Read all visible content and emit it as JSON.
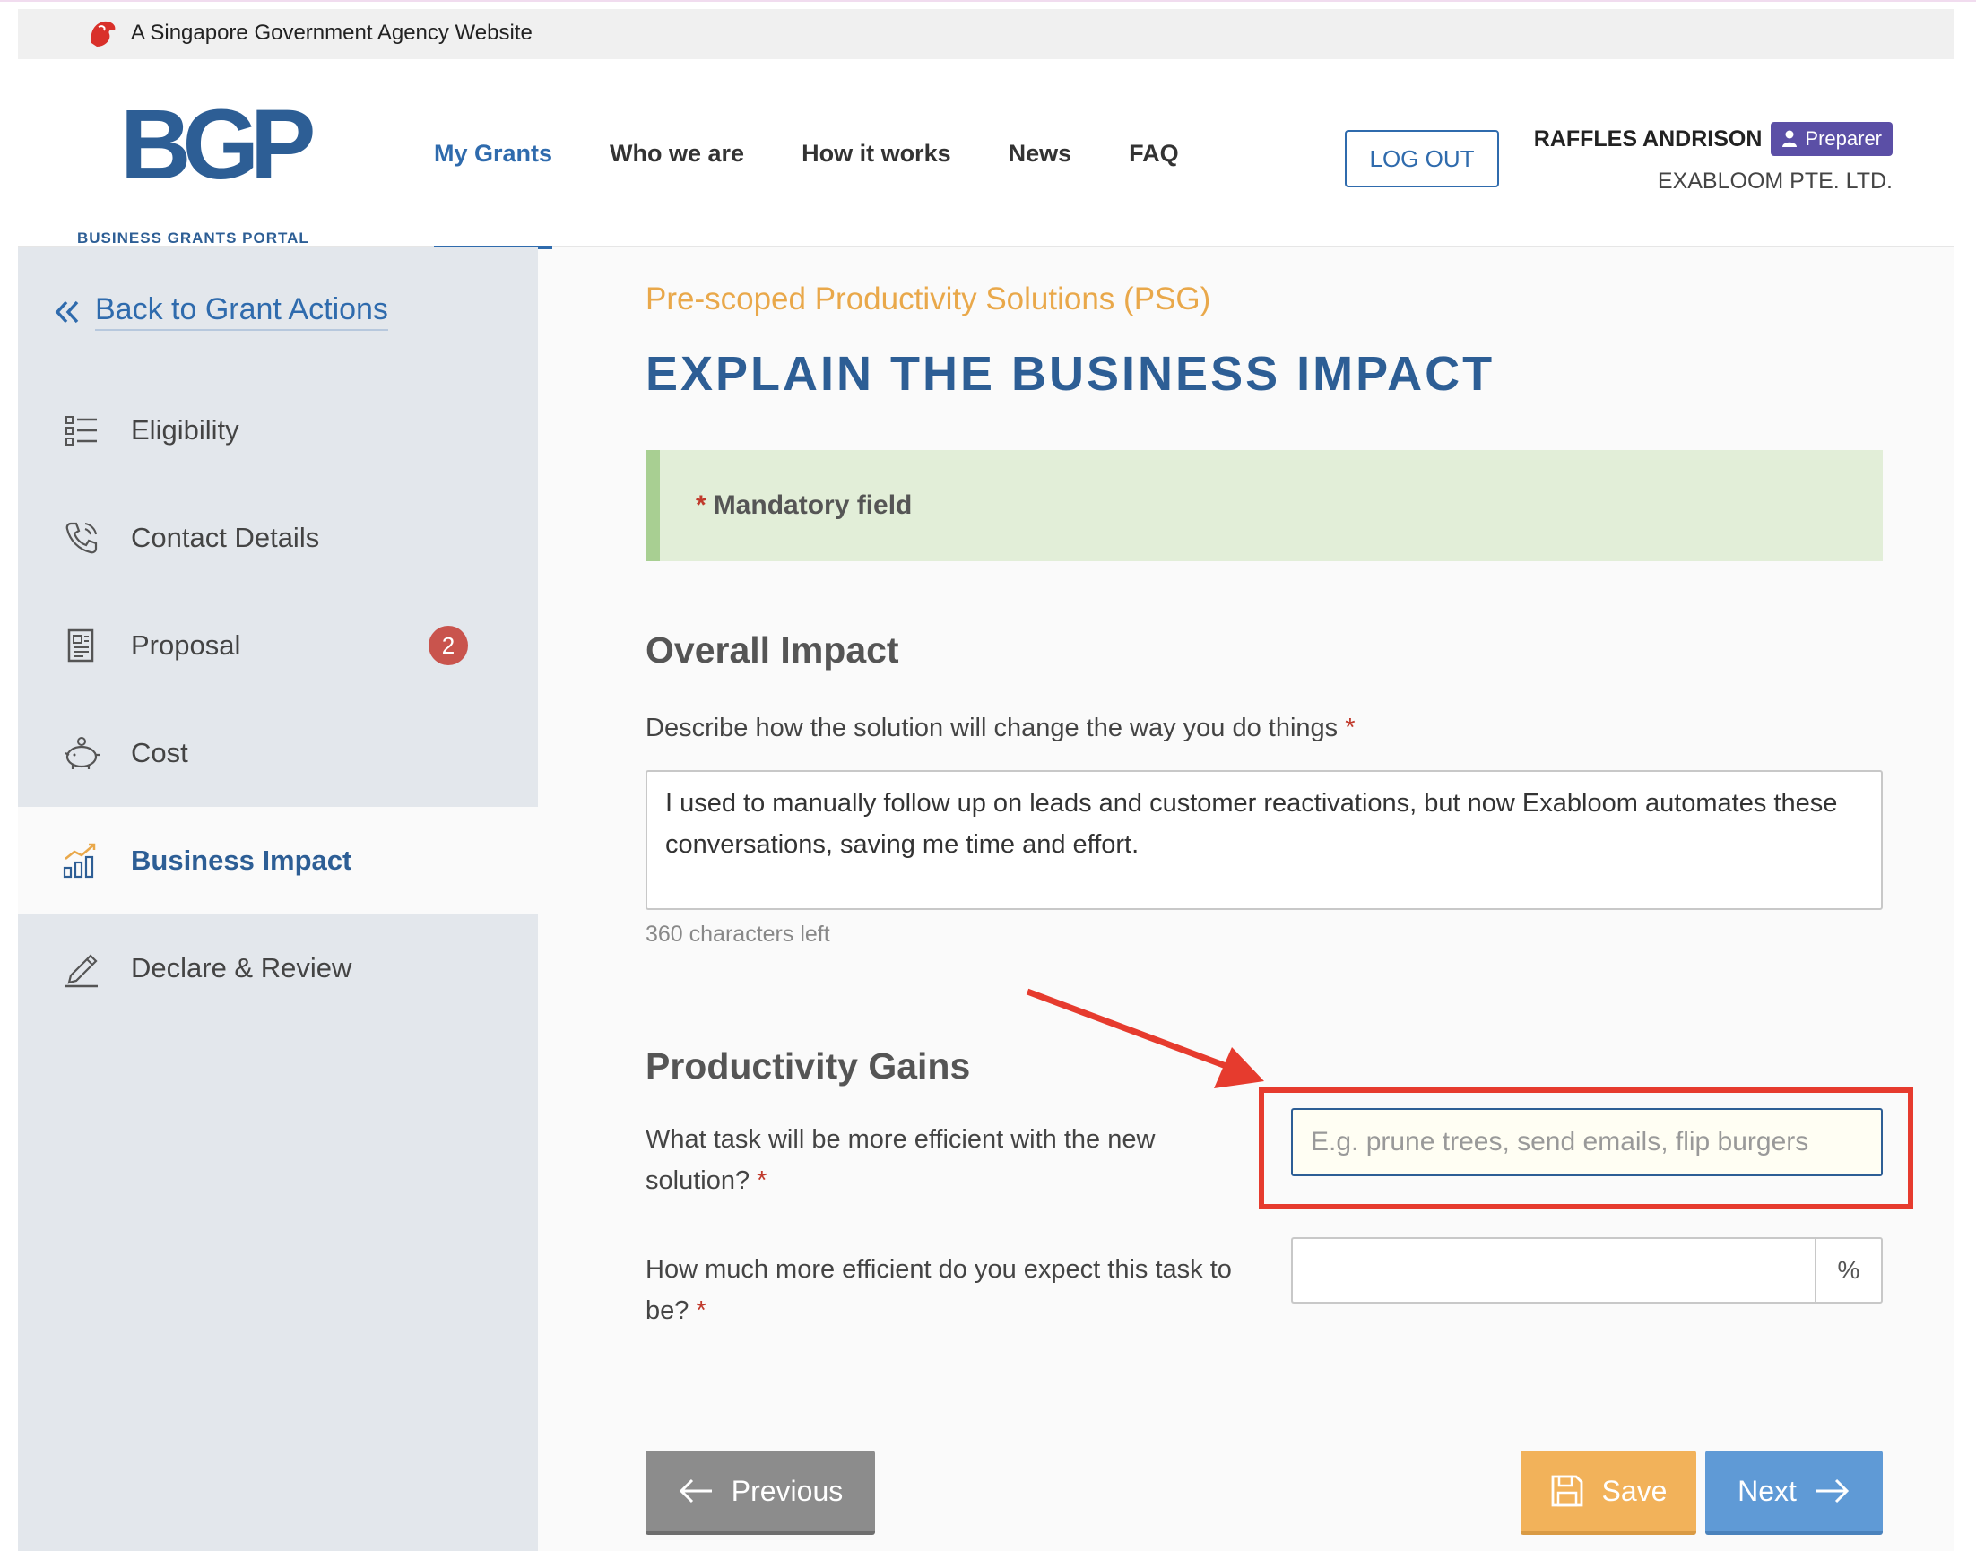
{
  "masthead": {
    "text": "A Singapore Government Agency Website"
  },
  "logo": {
    "mark": "BGP",
    "tagline": "BUSINESS GRANTS PORTAL"
  },
  "nav": {
    "items": [
      {
        "label": "My Grants",
        "active": true
      },
      {
        "label": "Who we are"
      },
      {
        "label": "How it works"
      },
      {
        "label": "News"
      },
      {
        "label": "FAQ"
      }
    ],
    "logout_label": "LOG OUT"
  },
  "user": {
    "name": "RAFFLES ANDRISON",
    "role": "Preparer",
    "company": "EXABLOOM PTE. LTD."
  },
  "sidebar": {
    "back_label": "Back to Grant Actions",
    "items": [
      {
        "label": "Eligibility",
        "icon": "list-icon"
      },
      {
        "label": "Contact Details",
        "icon": "phone-icon"
      },
      {
        "label": "Proposal",
        "icon": "document-icon",
        "badge": "2"
      },
      {
        "label": "Cost",
        "icon": "piggy-bank-icon"
      },
      {
        "label": "Business Impact",
        "icon": "bar-chart-icon",
        "active": true
      },
      {
        "label": "Declare & Review",
        "icon": "pen-icon"
      }
    ]
  },
  "main": {
    "grant_name": "Pre-scoped Productivity Solutions (PSG)",
    "title": "EXPLAIN THE BUSINESS IMPACT",
    "notice": {
      "asterisk": "*",
      "text": "Mandatory field"
    },
    "overall": {
      "heading": "Overall Impact",
      "label": "Describe how the solution will change the way you do things",
      "asterisk": "*",
      "value": "I used to manually follow up on leads and customer reactivations, but now Exabloom automates these conversations, saving me time and effort.",
      "chars_left": "360 characters left"
    },
    "productivity": {
      "heading": "Productivity Gains",
      "task_label": "What task will be more efficient with the new solution?",
      "task_placeholder": "E.g. prune trees, send emails, flip burgers",
      "eff_label": "How much more efficient do you expect this task to be?",
      "eff_unit": "%",
      "asterisk": "*"
    },
    "buttons": {
      "previous": "Previous",
      "save": "Save",
      "next": "Next"
    }
  },
  "colors": {
    "primary": "#2d5e95",
    "accent": "#e9a84a",
    "annotation": "#e63b2e"
  }
}
